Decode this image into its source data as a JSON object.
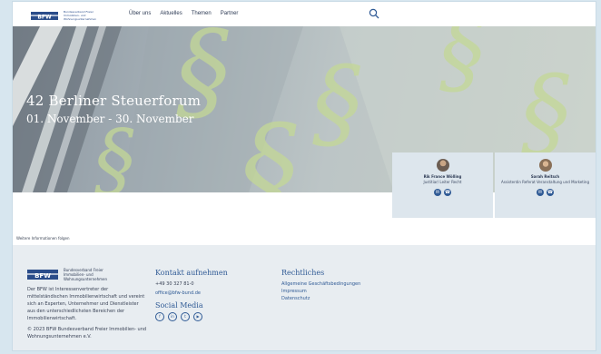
{
  "header": {
    "logo_text": "Bundesverband Freier Immobilien- und Wohnungsunternehmen",
    "nav": [
      {
        "label": "Über uns"
      },
      {
        "label": "Aktuelles"
      },
      {
        "label": "Themen"
      },
      {
        "label": "Partner"
      }
    ]
  },
  "hero": {
    "title": "42 Berliner Steuerforum",
    "dates": "01. November - 30. November"
  },
  "contacts": [
    {
      "name": "Rik France Wölling",
      "role": "Justitiar/ Leiter Recht"
    },
    {
      "name": "Sarah Reitsch",
      "role": "Assistentin Referat Veranstaltung und Marketing"
    }
  ],
  "more_info": "Weitere Informationen folgen",
  "footer": {
    "logo_text": "Bundesverband Freier Immobilien- und Wohnungsunternehmen",
    "description": "Der BFW ist Interessenvertreter der mittelständischen Immobilienwirtschaft und vereint sich an Experten, Unternehmer und Dienstleister aus den unterschiedlichsten Bereichen der Immobilienwirtschaft.",
    "copyright": "© 2023 BFW Bundesverband Freier Immobilien- und Wohnungsunternehmen e.V.",
    "contact": {
      "heading": "Kontakt aufnehmen",
      "phone": "+49 30 327 81-0",
      "email": "office@bfw-bund.de"
    },
    "social": {
      "heading": "Social Media"
    },
    "legal": {
      "heading": "Rechtliches",
      "links": [
        {
          "label": "Allgemeine Geschäftsbedingungen"
        },
        {
          "label": "Impressum"
        },
        {
          "label": "Datenschutz"
        }
      ]
    }
  },
  "colors": {
    "accent": "#2f5a95",
    "highlight": "#c4d896"
  }
}
